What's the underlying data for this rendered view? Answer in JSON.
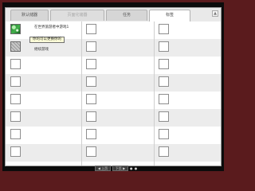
{
  "tabs": [
    {
      "label": "默认储器",
      "state": "normal"
    },
    {
      "label": "页面化储器",
      "state": "disabled"
    },
    {
      "label": "任务",
      "state": "normal"
    },
    {
      "label": "标签",
      "state": "active"
    }
  ],
  "scroll_icon": "up-arrow",
  "scroll_glyph": "▲",
  "items": [
    {
      "thumb": "green",
      "label": "在世界旅游者中游戏1"
    },
    {
      "thumb": "gray",
      "label": "继续游戏"
    }
  ],
  "tooltip": "你的可以更换你的",
  "pager": {
    "prev_label": "◀ 上页",
    "next_label": "下页 ▶",
    "dots": "● ●"
  }
}
